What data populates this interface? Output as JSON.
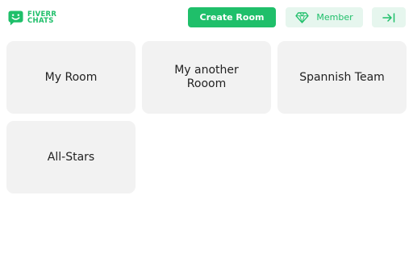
{
  "brand": {
    "line1": "FIVERR",
    "line2": "CHATS",
    "icon": "chat-smile-icon",
    "color": "#1fbf6a"
  },
  "header": {
    "create_label": "Create Room",
    "member_label": "Member",
    "member_icon": "diamond-icon",
    "exit_icon": "arrow-to-line-icon"
  },
  "colors": {
    "accent": "#1fbf6a",
    "accent_light": "#e6f6ee",
    "card_bg": "#f2f2f2",
    "text": "#222222"
  },
  "rooms": [
    {
      "name": "My Room"
    },
    {
      "name": "My another Rooom"
    },
    {
      "name": "Spannish Team"
    },
    {
      "name": "All-Stars"
    }
  ]
}
